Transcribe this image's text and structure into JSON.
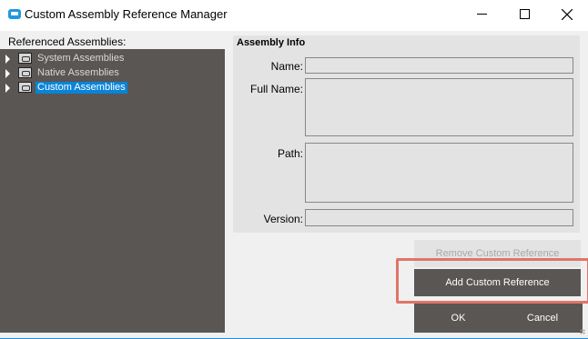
{
  "window": {
    "title": "Custom Assembly Reference Manager",
    "icon": "app-icon",
    "controls": [
      "minimize",
      "maximize",
      "close"
    ]
  },
  "left_panel": {
    "label": "Referenced Assemblies:",
    "tree": [
      {
        "label": "System Assemblies",
        "icon": "assembly-folder-icon",
        "selected": false
      },
      {
        "label": "Native Assemblies",
        "icon": "assembly-folder-icon",
        "selected": false
      },
      {
        "label": "Custom Assemblies",
        "icon": "assembly-folder-icon",
        "selected": true
      }
    ]
  },
  "assembly_info": {
    "title": "Assembly Info",
    "fields": {
      "name_label": "Name:",
      "name_value": "",
      "full_name_label": "Full Name:",
      "full_name_value": "",
      "path_label": "Path:",
      "path_value": "",
      "version_label": "Version:",
      "version_value": ""
    }
  },
  "buttons": {
    "remove_label": "Remove Custom Reference",
    "add_label": "Add Custom Reference",
    "ok_label": "OK",
    "cancel_label": "Cancel"
  },
  "colors": {
    "tree_background": "#5a5654",
    "selection": "#0a84d8",
    "highlight_border": "#e07568",
    "button_dark": "#5a5654",
    "title_icon": "#1f9ae0"
  }
}
